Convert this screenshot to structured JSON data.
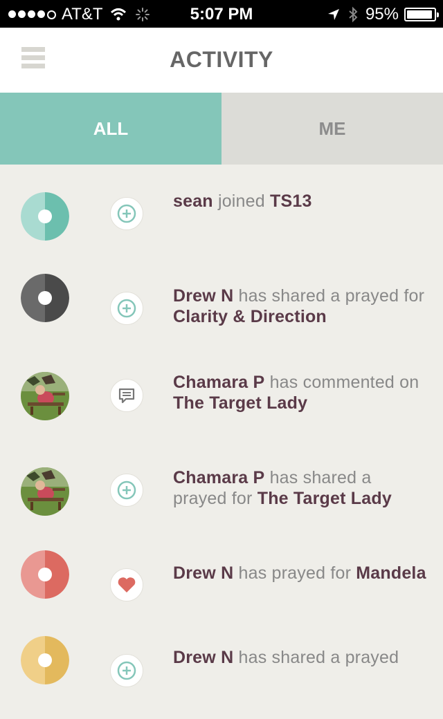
{
  "status_bar": {
    "carrier": "AT&T",
    "time": "5:07 PM",
    "battery": "95%"
  },
  "header": {
    "title": "ACTIVITY"
  },
  "tabs": [
    {
      "label": "ALL",
      "active": true
    },
    {
      "label": "ME",
      "active": false
    }
  ],
  "feed": [
    {
      "avatar": "teal-circle",
      "action_icon": "plus-circle-icon",
      "user": "sean",
      "verb": " joined ",
      "object": "TS13"
    },
    {
      "avatar": "dark-circle",
      "action_icon": "plus-circle-icon",
      "user": "Drew N",
      "verb": " has shared a prayed for ",
      "object": "Clarity & Direction"
    },
    {
      "avatar": "photo",
      "action_icon": "comment-icon",
      "user": "Chamara P",
      "verb": " has commented on ",
      "object": "The Target Lady"
    },
    {
      "avatar": "photo",
      "action_icon": "plus-circle-icon",
      "user": "Chamara P",
      "verb": " has shared a prayed for ",
      "object": "The Target Lady"
    },
    {
      "avatar": "red-circle",
      "action_icon": "heart-icon",
      "user": "Drew N",
      "verb": " has prayed for ",
      "object": "Mandela"
    },
    {
      "avatar": "yellow-circle",
      "action_icon": "plus-circle-icon",
      "user": "Drew N",
      "verb": " has shared a prayed",
      "object": ""
    }
  ],
  "colors": {
    "accent": "#84c6b9",
    "username": "#5a3a48",
    "secondary_text": "#888888",
    "background": "#efeee9"
  }
}
